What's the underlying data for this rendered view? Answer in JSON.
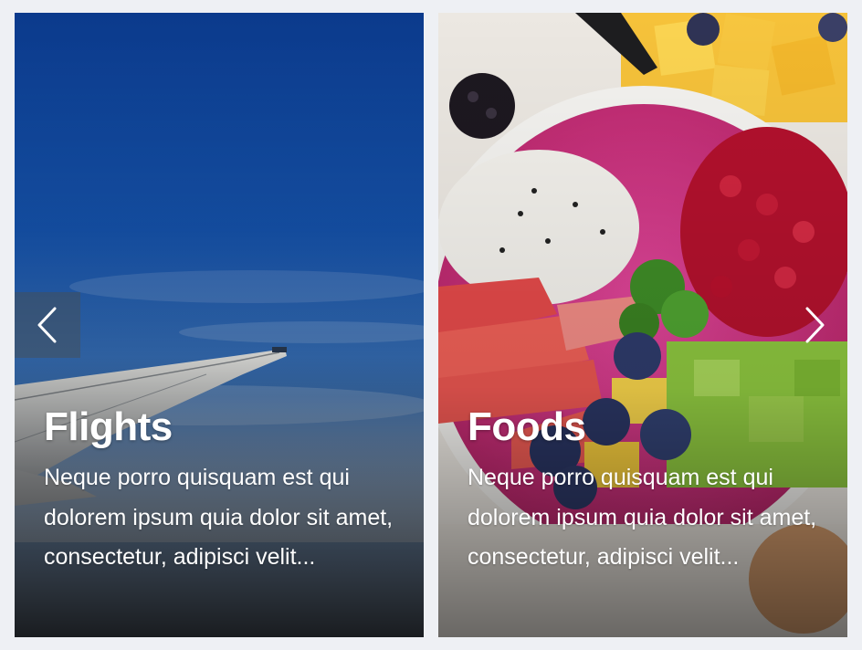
{
  "carousel": {
    "slides": [
      {
        "title": "Flights",
        "text": "Neque porro quisquam est qui dolorem ipsum quia dolor sit amet, consectetur, adipisci velit...",
        "image": "airplane-wing-sky"
      },
      {
        "title": "Foods",
        "text": "Neque porro quisquam est qui dolorem ipsum quia dolor sit amet, consectetur, adipisci velit...",
        "image": "fruit-smoothie-bowl"
      }
    ],
    "controls": {
      "prev_icon": "chevron-left-icon",
      "next_icon": "chevron-right-icon"
    }
  },
  "colors": {
    "page_background": "#eef0f4",
    "sky_top": "#0d3f8f",
    "sky_bottom": "#6f97c6",
    "smoothie_pink": "#d3357f",
    "caption_text": "#ffffff"
  }
}
